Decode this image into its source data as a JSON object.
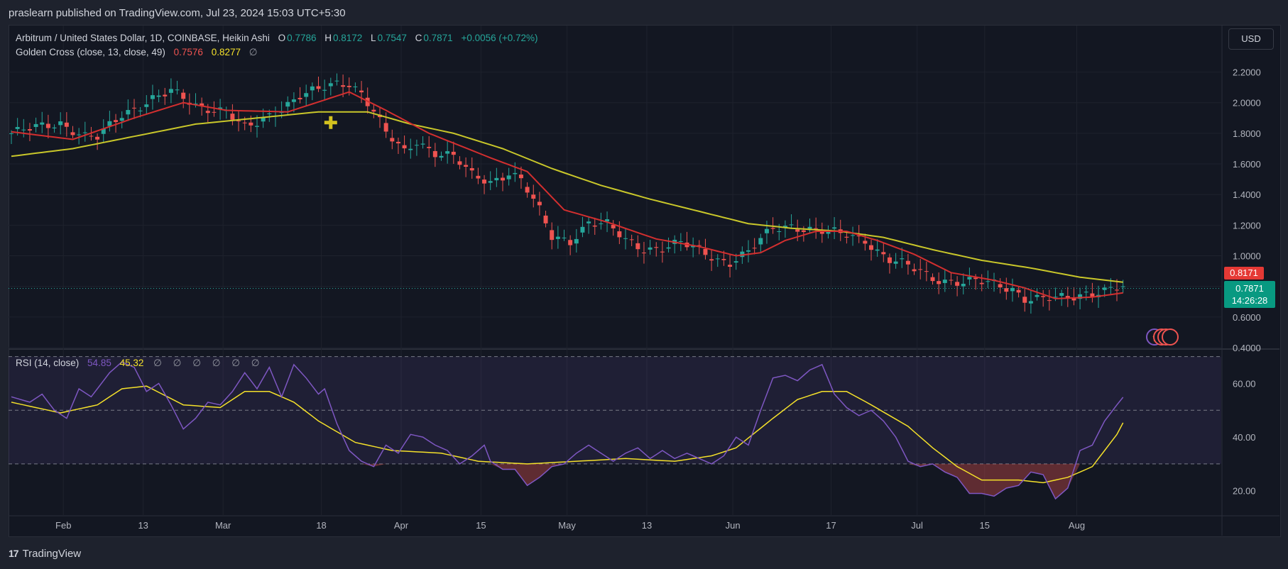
{
  "publisher_line": "praslearn published on TradingView.com, Jul 23, 2024 15:03 UTC+5:30",
  "footer_brand": "TradingView",
  "footer_mark": "17",
  "currency_button": "USD",
  "symbol_legend": {
    "title": "Arbitrum / United States Dollar, 1D, COINBASE, Heikin Ashi",
    "o_label": "O",
    "o_value": "0.7786",
    "h_label": "H",
    "h_value": "0.8172",
    "l_label": "L",
    "l_value": "0.7547",
    "c_label": "C",
    "c_value": "0.7871",
    "change": "+0.0056 (+0.72%)"
  },
  "golden_cross_legend": {
    "title": "Golden Cross (close, 13, close, 49)",
    "fast_value": "0.7576",
    "slow_value": "0.8277",
    "extra": "∅"
  },
  "rsi_legend": {
    "title": "RSI (14, close)",
    "rsi_value": "54.85",
    "ma_value": "45.32",
    "extras": "∅ ∅ ∅ ∅ ∅ ∅"
  },
  "price_tags": {
    "ma_slow_tag": "0.8171",
    "last_price": "0.7871",
    "countdown": "14:26:28"
  },
  "colors": {
    "up": "#26a69a",
    "down": "#ef5350",
    "fast_ma": "#d32f2f",
    "slow_ma": "#c9c72a",
    "rsi": "#7e57c2",
    "rsi_ma": "#f5e12a",
    "background": "#131722"
  },
  "chart_data": [
    {
      "type": "candlestick",
      "title": "Arbitrum / United States Dollar, 1D, COINBASE, Heikin Ashi",
      "ylim": [
        0.4,
        2.3
      ],
      "y_ticks": [
        "2.2000",
        "2.0000",
        "1.8000",
        "1.6000",
        "1.4000",
        "1.2000",
        "1.0000",
        "0.8000",
        "0.6000",
        "0.4000"
      ],
      "x_ticks": [
        "Feb",
        "13",
        "Mar",
        "18",
        "Apr",
        "15",
        "May",
        "13",
        "Jun",
        "17",
        "Jul",
        "15",
        "Aug"
      ],
      "close_path": [
        [
          0,
          1.8
        ],
        [
          8,
          1.87
        ],
        [
          12,
          1.78
        ],
        [
          14,
          1.77
        ],
        [
          18,
          1.92
        ],
        [
          23,
          2.03
        ],
        [
          26,
          2.07
        ],
        [
          30,
          1.98
        ],
        [
          35,
          1.95
        ],
        [
          38,
          1.83
        ],
        [
          40,
          1.86
        ],
        [
          44,
          1.97
        ],
        [
          47,
          2.05
        ],
        [
          50,
          2.08
        ],
        [
          53,
          2.12
        ],
        [
          55,
          2.13
        ],
        [
          57,
          2.07
        ],
        [
          59,
          1.95
        ],
        [
          61,
          1.8
        ],
        [
          64,
          1.67
        ],
        [
          66,
          1.75
        ],
        [
          69,
          1.68
        ],
        [
          72,
          1.65
        ],
        [
          75,
          1.52
        ],
        [
          78,
          1.48
        ],
        [
          81,
          1.55
        ],
        [
          83,
          1.5
        ],
        [
          86,
          1.29
        ],
        [
          88,
          1.12
        ],
        [
          91,
          1.1
        ],
        [
          94,
          1.22
        ],
        [
          97,
          1.2
        ],
        [
          100,
          1.1
        ],
        [
          103,
          1.05
        ],
        [
          106,
          1.05
        ],
        [
          109,
          1.08
        ],
        [
          112,
          1.04
        ],
        [
          115,
          0.98
        ],
        [
          117,
          0.96
        ],
        [
          120,
          1.02
        ],
        [
          122,
          1.1
        ],
        [
          124,
          1.18
        ],
        [
          127,
          1.2
        ],
        [
          130,
          1.17
        ],
        [
          133,
          1.15
        ],
        [
          136,
          1.14
        ],
        [
          139,
          1.11
        ],
        [
          141,
          1.03
        ],
        [
          143,
          0.97
        ],
        [
          146,
          0.93
        ],
        [
          148,
          0.9
        ],
        [
          150,
          0.86
        ],
        [
          152,
          0.84
        ],
        [
          155,
          0.82
        ],
        [
          157,
          0.83
        ],
        [
          160,
          0.82
        ],
        [
          163,
          0.79
        ],
        [
          165,
          0.72
        ],
        [
          168,
          0.71
        ],
        [
          170,
          0.72
        ],
        [
          172,
          0.73
        ],
        [
          175,
          0.76
        ],
        [
          178,
          0.77
        ],
        [
          181,
          0.79
        ]
      ],
      "series": [
        {
          "name": "Golden Cross fast (13)",
          "last": 0.7576,
          "points": [
            [
              0,
              1.81
            ],
            [
              10,
              1.76
            ],
            [
              20,
              1.9
            ],
            [
              28,
              2.0
            ],
            [
              35,
              1.95
            ],
            [
              45,
              1.94
            ],
            [
              55,
              2.07
            ],
            [
              61,
              1.95
            ],
            [
              68,
              1.8
            ],
            [
              78,
              1.64
            ],
            [
              84,
              1.55
            ],
            [
              90,
              1.3
            ],
            [
              97,
              1.22
            ],
            [
              105,
              1.11
            ],
            [
              112,
              1.06
            ],
            [
              118,
              1.0
            ],
            [
              122,
              1.02
            ],
            [
              126,
              1.1
            ],
            [
              131,
              1.16
            ],
            [
              136,
              1.16
            ],
            [
              141,
              1.1
            ],
            [
              147,
              1.01
            ],
            [
              153,
              0.89
            ],
            [
              160,
              0.84
            ],
            [
              165,
              0.79
            ],
            [
              170,
              0.72
            ],
            [
              176,
              0.73
            ],
            [
              181,
              0.7576
            ]
          ]
        },
        {
          "name": "Golden Cross slow (49)",
          "last": 0.8277,
          "points": [
            [
              0,
              1.65
            ],
            [
              10,
              1.7
            ],
            [
              20,
              1.78
            ],
            [
              30,
              1.86
            ],
            [
              40,
              1.9
            ],
            [
              50,
              1.94
            ],
            [
              58,
              1.94
            ],
            [
              65,
              1.86
            ],
            [
              72,
              1.8
            ],
            [
              80,
              1.7
            ],
            [
              88,
              1.57
            ],
            [
              96,
              1.46
            ],
            [
              104,
              1.37
            ],
            [
              112,
              1.29
            ],
            [
              120,
              1.21
            ],
            [
              127,
              1.18
            ],
            [
              135,
              1.16
            ],
            [
              142,
              1.12
            ],
            [
              150,
              1.04
            ],
            [
              158,
              0.97
            ],
            [
              166,
              0.92
            ],
            [
              174,
              0.86
            ],
            [
              181,
              0.8277
            ]
          ]
        }
      ],
      "markers": [
        {
          "type": "golden-cross",
          "x": 52,
          "y": 1.87
        }
      ]
    },
    {
      "type": "line",
      "title": "RSI (14, close)",
      "ylim": [
        12,
        72
      ],
      "y_ticks": [
        "60.00",
        "40.00",
        "20.00"
      ],
      "bands": [
        70,
        50,
        30
      ],
      "series": [
        {
          "name": "RSI",
          "last": 54.85,
          "points": [
            [
              0,
              55
            ],
            [
              3,
              53
            ],
            [
              5,
              56
            ],
            [
              7,
              50
            ],
            [
              9,
              47
            ],
            [
              11,
              58
            ],
            [
              13,
              55
            ],
            [
              16,
              64
            ],
            [
              18,
              68
            ],
            [
              20,
              66
            ],
            [
              22,
              57
            ],
            [
              24,
              60
            ],
            [
              26,
              52
            ],
            [
              28,
              43
            ],
            [
              30,
              47
            ],
            [
              32,
              53
            ],
            [
              34,
              52
            ],
            [
              36,
              57
            ],
            [
              38,
              64
            ],
            [
              40,
              58
            ],
            [
              42,
              66
            ],
            [
              44,
              55
            ],
            [
              46,
              67
            ],
            [
              48,
              62
            ],
            [
              50,
              56
            ],
            [
              51,
              58
            ],
            [
              53,
              45
            ],
            [
              55,
              35
            ],
            [
              57,
              31
            ],
            [
              59,
              29
            ],
            [
              61,
              37
            ],
            [
              63,
              34
            ],
            [
              65,
              41
            ],
            [
              67,
              40
            ],
            [
              69,
              37
            ],
            [
              71,
              35
            ],
            [
              73,
              30
            ],
            [
              75,
              33
            ],
            [
              77,
              37
            ],
            [
              78,
              31
            ],
            [
              80,
              28
            ],
            [
              82,
              28
            ],
            [
              84,
              22
            ],
            [
              86,
              25
            ],
            [
              88,
              29
            ],
            [
              90,
              30
            ],
            [
              92,
              34
            ],
            [
              94,
              37
            ],
            [
              96,
              34
            ],
            [
              98,
              31
            ],
            [
              100,
              34
            ],
            [
              102,
              36
            ],
            [
              104,
              32
            ],
            [
              106,
              35
            ],
            [
              108,
              32
            ],
            [
              110,
              34
            ],
            [
              112,
              32
            ],
            [
              114,
              30
            ],
            [
              116,
              33
            ],
            [
              118,
              40
            ],
            [
              120,
              37
            ],
            [
              122,
              50
            ],
            [
              124,
              62
            ],
            [
              126,
              63
            ],
            [
              128,
              61
            ],
            [
              130,
              65
            ],
            [
              132,
              67
            ],
            [
              134,
              56
            ],
            [
              136,
              51
            ],
            [
              138,
              48
            ],
            [
              140,
              50
            ],
            [
              142,
              46
            ],
            [
              144,
              40
            ],
            [
              146,
              31
            ],
            [
              148,
              29
            ],
            [
              150,
              30
            ],
            [
              152,
              27
            ],
            [
              154,
              25
            ],
            [
              156,
              19
            ],
            [
              158,
              19
            ],
            [
              160,
              18
            ],
            [
              162,
              21
            ],
            [
              164,
              22
            ],
            [
              166,
              27
            ],
            [
              168,
              26
            ],
            [
              170,
              17
            ],
            [
              172,
              21
            ],
            [
              174,
              35
            ],
            [
              176,
              37
            ],
            [
              178,
              46
            ],
            [
              180,
              52
            ],
            [
              181,
              54.85
            ]
          ]
        },
        {
          "name": "RSI-based MA",
          "last": 45.32,
          "points": [
            [
              0,
              53
            ],
            [
              8,
              49
            ],
            [
              14,
              52
            ],
            [
              18,
              58
            ],
            [
              22,
              59
            ],
            [
              28,
              52
            ],
            [
              34,
              51
            ],
            [
              38,
              57
            ],
            [
              42,
              57
            ],
            [
              46,
              53
            ],
            [
              50,
              46
            ],
            [
              56,
              38
            ],
            [
              62,
              35
            ],
            [
              70,
              34
            ],
            [
              76,
              31
            ],
            [
              84,
              30
            ],
            [
              92,
              31
            ],
            [
              100,
              32
            ],
            [
              108,
              31
            ],
            [
              114,
              33
            ],
            [
              118,
              36
            ],
            [
              124,
              47
            ],
            [
              128,
              54
            ],
            [
              132,
              57
            ],
            [
              136,
              57
            ],
            [
              140,
              52
            ],
            [
              146,
              44
            ],
            [
              150,
              36
            ],
            [
              154,
              29
            ],
            [
              158,
              24
            ],
            [
              164,
              24
            ],
            [
              168,
              23
            ],
            [
              172,
              25
            ],
            [
              176,
              29
            ],
            [
              180,
              41
            ],
            [
              181,
              45.32
            ]
          ]
        }
      ]
    }
  ]
}
